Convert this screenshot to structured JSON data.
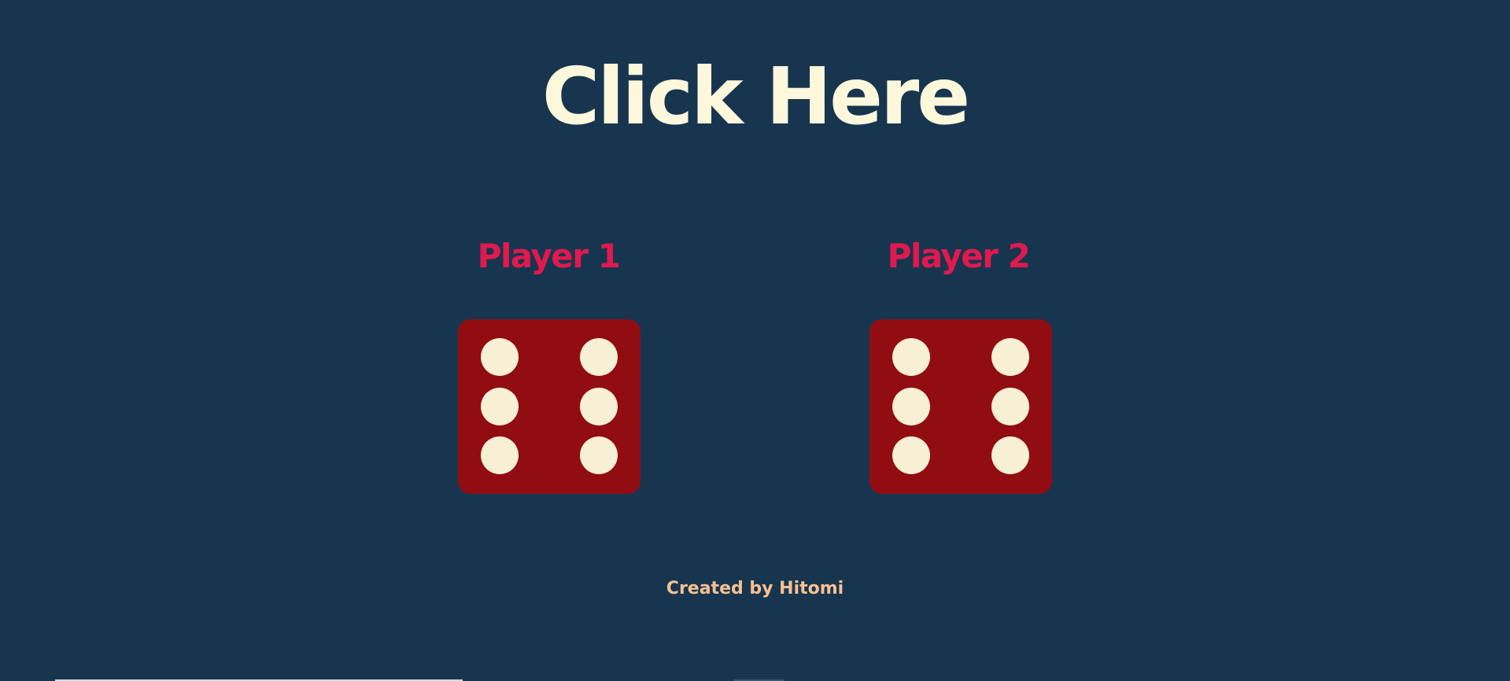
{
  "title": "Click Here",
  "players": [
    {
      "label": "Player 1",
      "die_value": 6
    },
    {
      "label": "Player 2",
      "die_value": 6
    }
  ],
  "footer": "Created by Hitomi",
  "colors": {
    "background": "#18354f",
    "title": "#fdf7dc",
    "player_label": "#e0194e",
    "die_face": "#920d12",
    "die_pip": "#f8f0d5",
    "footer": "#f6c192"
  }
}
